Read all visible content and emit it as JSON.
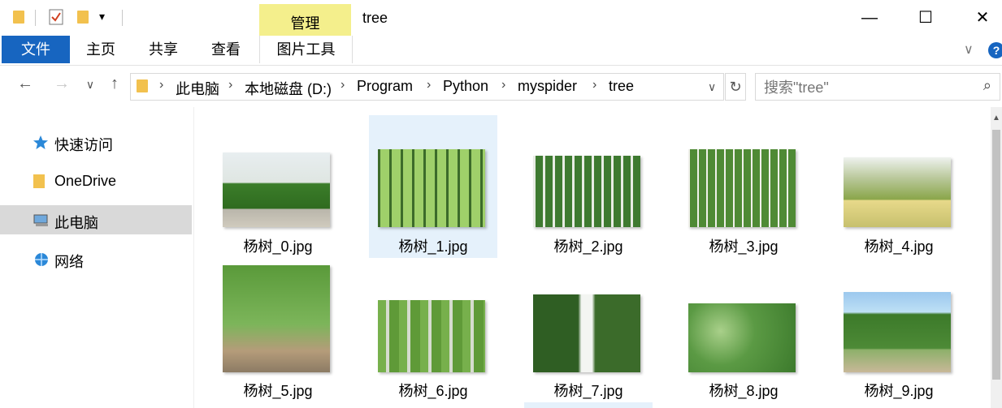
{
  "window": {
    "title": "tree",
    "contextual_tab_group": "管理",
    "controls": {
      "minimize": "—",
      "maximize": "☐",
      "close": "✕"
    }
  },
  "quick_access_toolbar": {
    "dropdown_glyph": "▾"
  },
  "ribbon": {
    "tabs": [
      {
        "label": "文件",
        "active": true
      },
      {
        "label": "主页"
      },
      {
        "label": "共享"
      },
      {
        "label": "查看"
      },
      {
        "label": "图片工具"
      }
    ],
    "expand_glyph": "∨",
    "help_glyph": "?"
  },
  "nav": {
    "back": "←",
    "forward": "→",
    "recent": "∨",
    "up": "↑",
    "breadcrumbs": [
      "此电脑",
      "本地磁盘 (D:)",
      "Program",
      "Python",
      "myspider",
      "tree"
    ],
    "separator": "›",
    "dropdown": "∨",
    "refresh": "↻"
  },
  "search": {
    "placeholder": "搜索\"tree\"",
    "icon_glyph": "⌕"
  },
  "sidebar": {
    "items": [
      {
        "label": "快速访问",
        "icon": "star-icon"
      },
      {
        "label": "OneDrive",
        "icon": "folder-icon"
      },
      {
        "label": "此电脑",
        "icon": "computer-icon",
        "selected": true
      },
      {
        "label": "网络",
        "icon": "network-icon"
      }
    ]
  },
  "files": [
    {
      "name": "杨树_0.jpg"
    },
    {
      "name": "杨树_1.jpg",
      "selected": true
    },
    {
      "name": "杨树_2.jpg"
    },
    {
      "name": "杨树_3.jpg"
    },
    {
      "name": "杨树_4.jpg"
    },
    {
      "name": "杨树_5.jpg"
    },
    {
      "name": "杨树_6.jpg"
    },
    {
      "name": "杨树_7.jpg"
    },
    {
      "name": "杨树_8.jpg"
    },
    {
      "name": "杨树_9.jpg"
    }
  ],
  "colors": {
    "accent": "#1765c0",
    "manage_tab": "#f4ef8c",
    "selection": "#e5f1fb",
    "sidebar_selected": "#d9d9d9"
  }
}
